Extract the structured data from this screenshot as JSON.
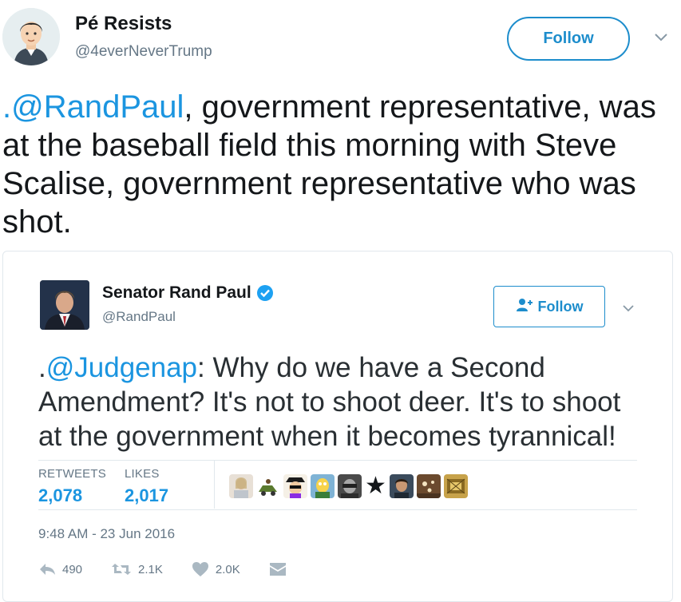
{
  "author": {
    "name": "Pé Resists",
    "handle": "@4everNeverTrump",
    "follow_label": "Follow"
  },
  "tweet": {
    "mention": ".@RandPaul",
    "text_rest": ", government representative, was at the baseball field this morning with Steve Scalise, government representative who was shot."
  },
  "quoted": {
    "name": "Senator Rand Paul",
    "handle": "@RandPaul",
    "follow_label": "Follow",
    "mention_prefix": ".",
    "mention": "@Judgenap",
    "text_rest": ": Why do we have a Second Amendment? It's not to shoot deer. It's to shoot at the government when it becomes tyrannical!",
    "retweets_label": "RETWEETS",
    "retweets_value": "2,078",
    "likes_label": "LIKES",
    "likes_value": "2,017",
    "timestamp": "9:48 AM - 23 Jun 2016",
    "actions": {
      "reply_count": "490",
      "retweet_count": "2.1K",
      "like_count": "2.0K"
    }
  },
  "colors": {
    "accent": "#1b95e0",
    "button_border": "#1d8dcc",
    "muted": "#657786",
    "text": "#14171a"
  },
  "icons": [
    "chevron-down-icon",
    "verified-badge-icon",
    "follow-person-icon",
    "reply-icon",
    "retweet-icon",
    "heart-icon",
    "direct-message-icon",
    "star-icon"
  ]
}
